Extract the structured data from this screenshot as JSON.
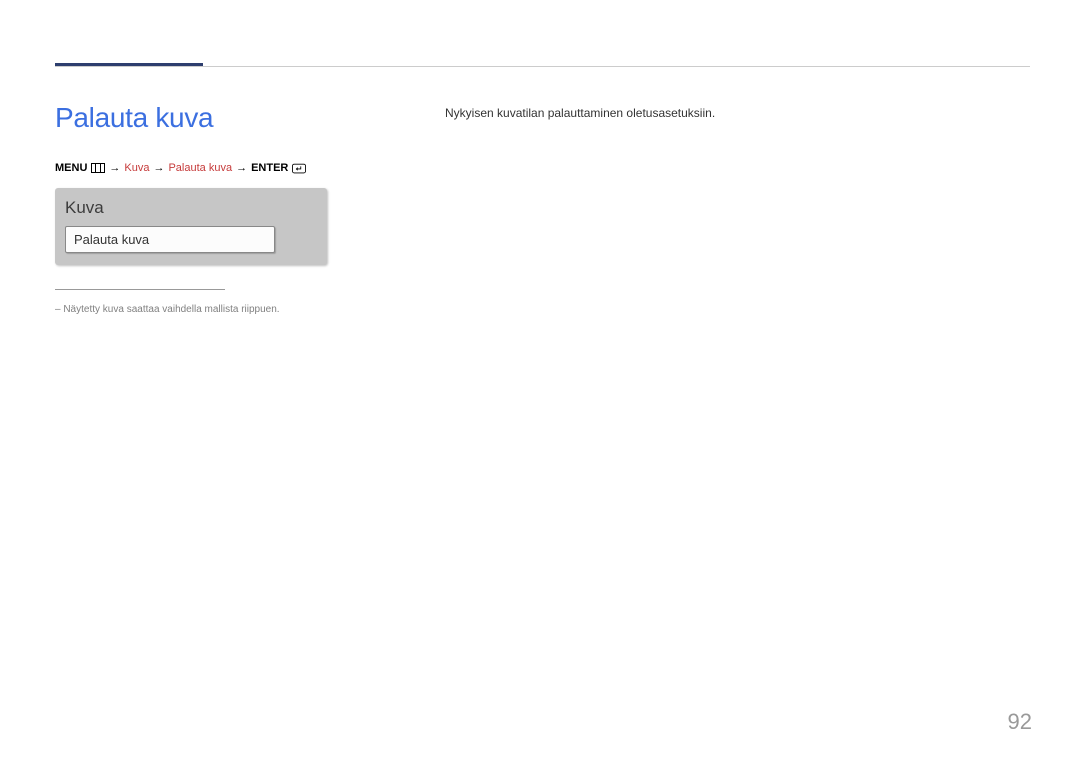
{
  "section_title": "Palauta kuva",
  "breadcrumb": {
    "menu_label": "MENU",
    "arrow": "→",
    "part1": "Kuva",
    "part2": "Palauta kuva",
    "enter_label": "ENTER"
  },
  "menu_panel": {
    "title": "Kuva",
    "item": "Palauta kuva"
  },
  "footnote": "– Näytetty kuva saattaa vaihdella mallista riippuen.",
  "description": "Nykyisen kuvatilan palauttaminen oletusasetuksiin.",
  "page_number": "92"
}
